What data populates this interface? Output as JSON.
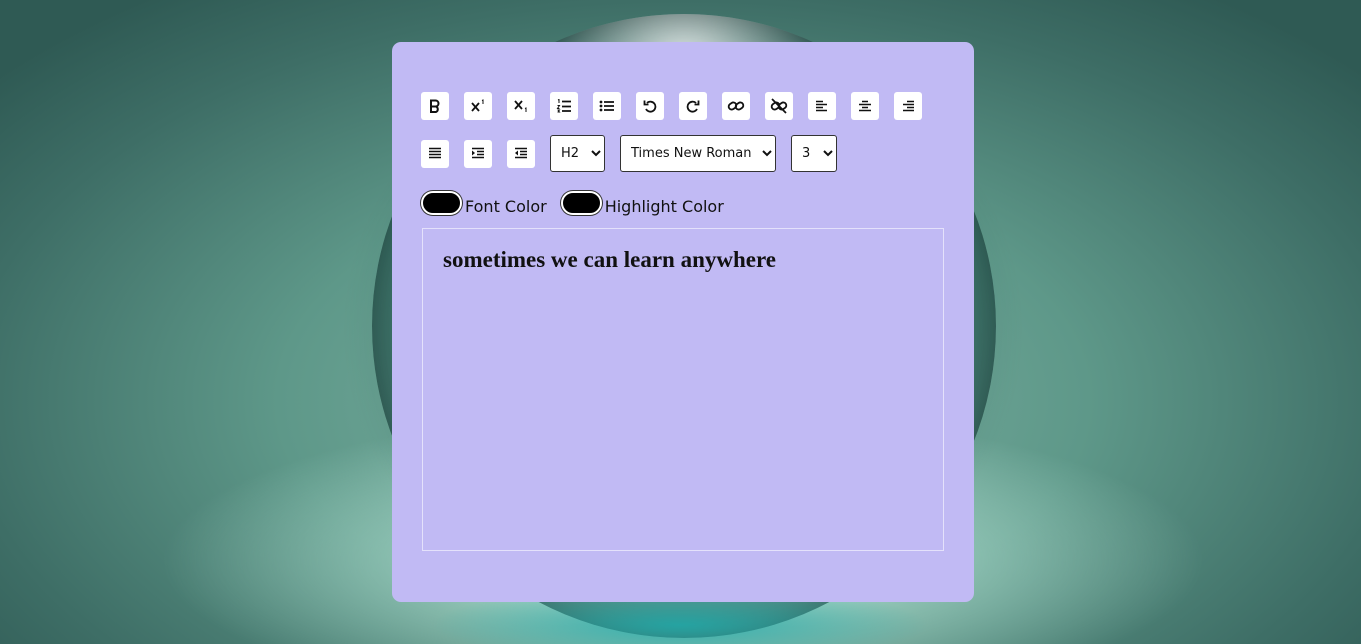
{
  "toolbar": {
    "row1": [
      {
        "name": "bold-button",
        "icon": "bold-icon"
      },
      {
        "name": "superscript-button",
        "icon": "superscript-icon"
      },
      {
        "name": "subscript-button",
        "icon": "subscript-icon"
      },
      {
        "name": "ordered-list-button",
        "icon": "ordered-list-icon"
      },
      {
        "name": "unordered-list-button",
        "icon": "unordered-list-icon"
      },
      {
        "name": "undo-button",
        "icon": "undo-icon"
      },
      {
        "name": "redo-button",
        "icon": "redo-icon"
      },
      {
        "name": "create-link-button",
        "icon": "link-icon"
      },
      {
        "name": "unlink-button",
        "icon": "unlink-icon"
      },
      {
        "name": "align-left-button",
        "icon": "align-left-icon"
      },
      {
        "name": "align-center-button",
        "icon": "align-center-icon"
      },
      {
        "name": "align-right-button",
        "icon": "align-right-icon"
      }
    ],
    "row2": [
      {
        "name": "justify-button",
        "icon": "justify-icon"
      },
      {
        "name": "indent-button",
        "icon": "indent-icon"
      },
      {
        "name": "outdent-button",
        "icon": "outdent-icon"
      }
    ],
    "heading_select": {
      "selected": "H2",
      "options": [
        "H2"
      ]
    },
    "font_select": {
      "selected": "Times New Roman",
      "options": [
        "Times New Roman"
      ]
    },
    "size_select": {
      "selected": "3",
      "options": [
        "3"
      ]
    }
  },
  "colors": {
    "font_color_label": "Font Color",
    "font_color_value": "#000000",
    "highlight_color_label": "Highlight Color",
    "highlight_color_value": "#000000",
    "card_background": "#c1baf4"
  },
  "editor": {
    "content": "sometimes we can learn anywhere"
  }
}
